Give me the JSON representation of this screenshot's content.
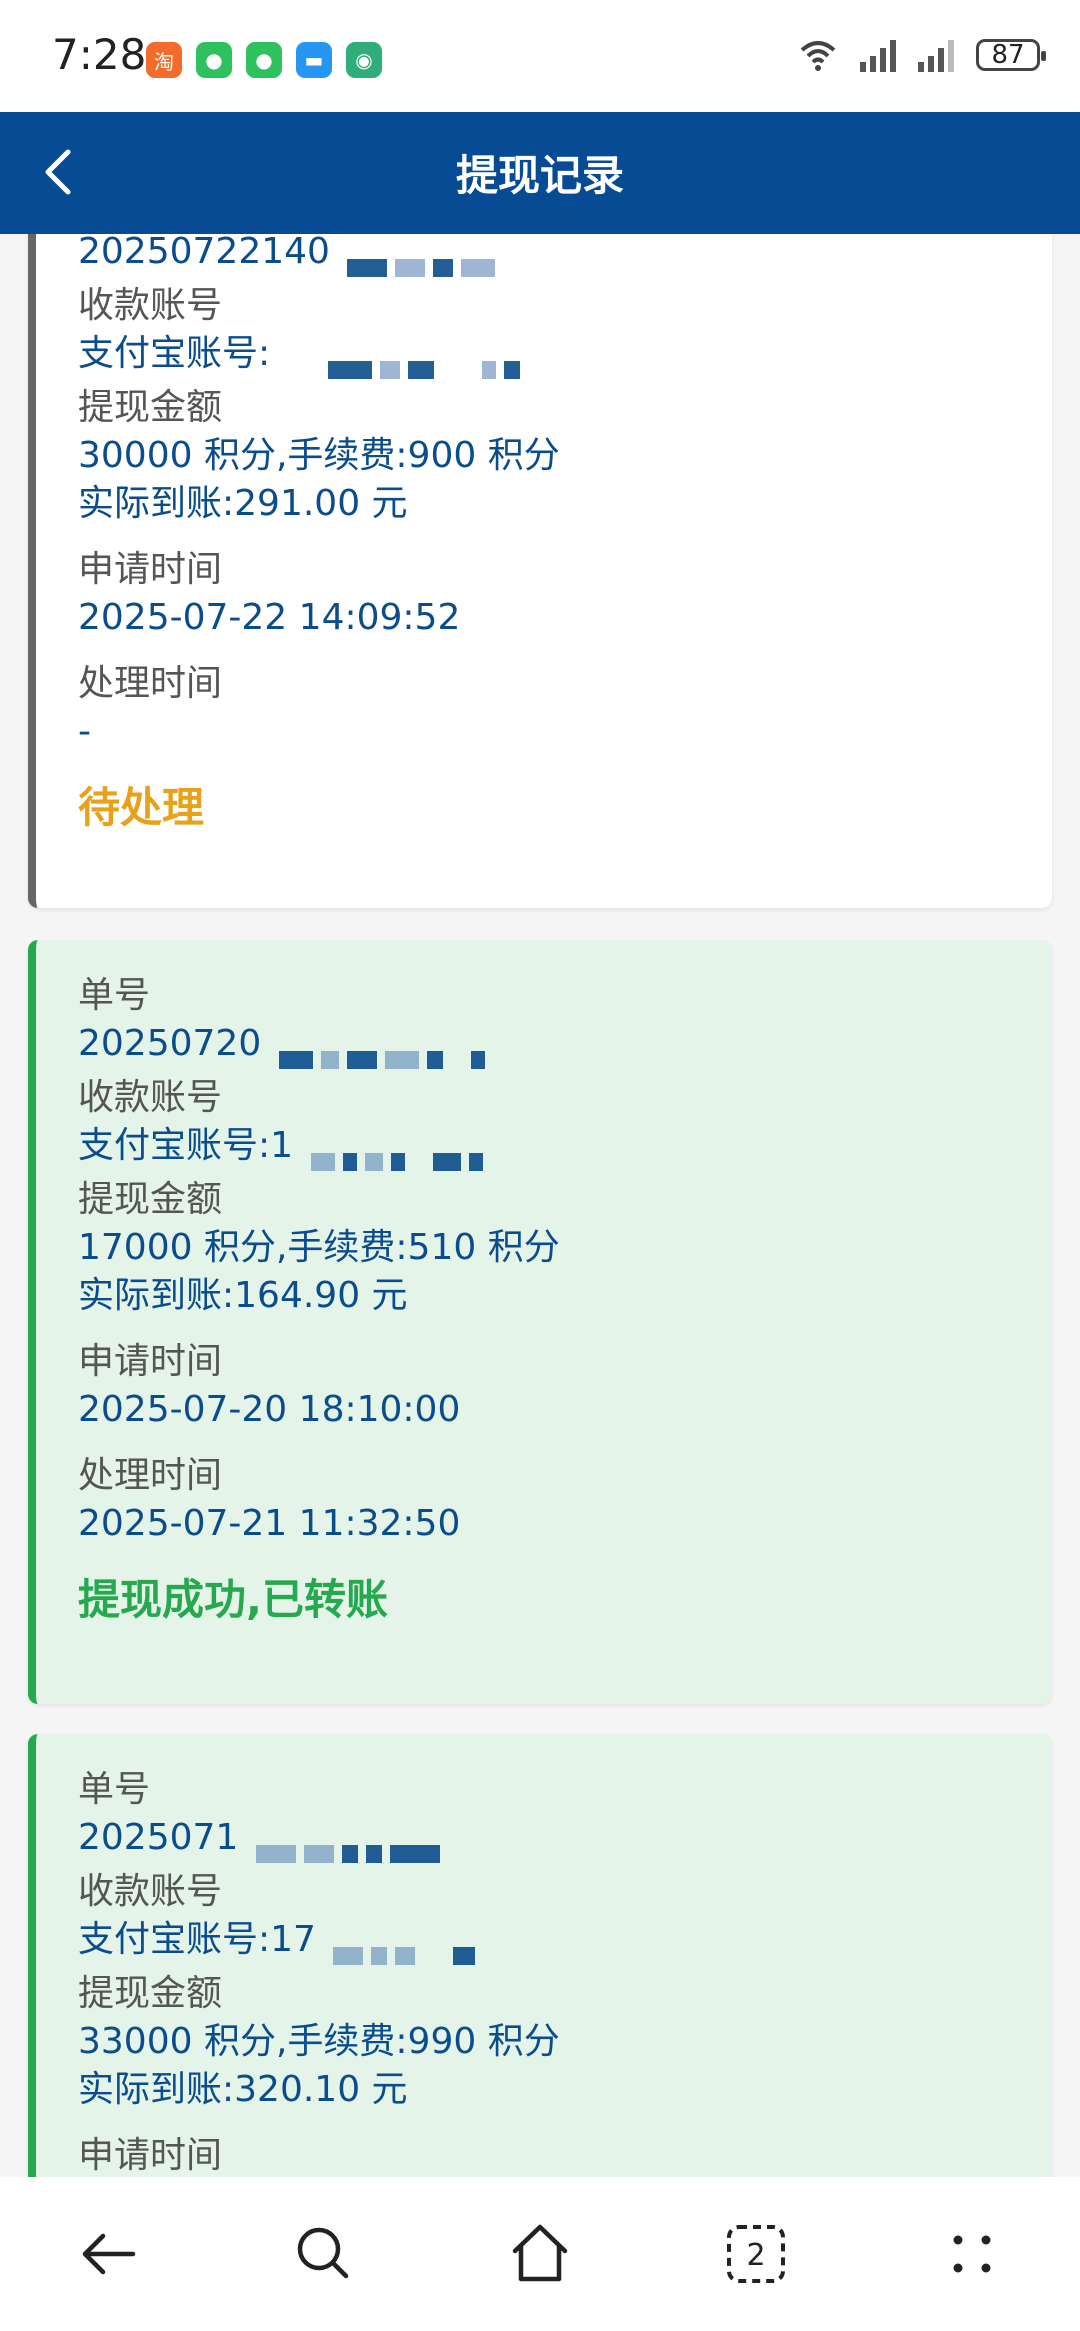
{
  "status_bar": {
    "time": "7:28",
    "battery": "87",
    "apps": [
      "taobao-icon",
      "wechat-icon",
      "wechat-icon",
      "message-icon",
      "tv-icon"
    ]
  },
  "header": {
    "title": "提现记录"
  },
  "labels": {
    "order_no": "单号",
    "account": "收款账号",
    "amount": "提现金额",
    "apply_time": "申请时间",
    "process_time": "处理时间"
  },
  "records": [
    {
      "order_no": "20250722140",
      "account": "支付宝账号:",
      "amount_line": "30000 积分,手续费:900 积分",
      "actual_line": "实际到账:291.00 元",
      "apply_time": "2025-07-22 14:09:52",
      "process_time": "-",
      "status": "待处理",
      "status_color": "#e8a21a"
    },
    {
      "order_no": "20250720",
      "account": "支付宝账号:1",
      "amount_line": "17000 积分,手续费:510 积分",
      "actual_line": "实际到账:164.90 元",
      "apply_time": "2025-07-20 18:10:00",
      "process_time": "2025-07-21 11:32:50",
      "status": "提现成功,已转账",
      "status_color": "#26a84f"
    },
    {
      "order_no": "2025071",
      "account": "支付宝账号:17",
      "amount_line": "33000 积分,手续费:990 积分",
      "actual_line": "实际到账:320.10 元"
    }
  ],
  "colors": {
    "header_bg": "#064b94",
    "value_text": "#0b4d8c",
    "success_bg": "#e4f4e8"
  }
}
